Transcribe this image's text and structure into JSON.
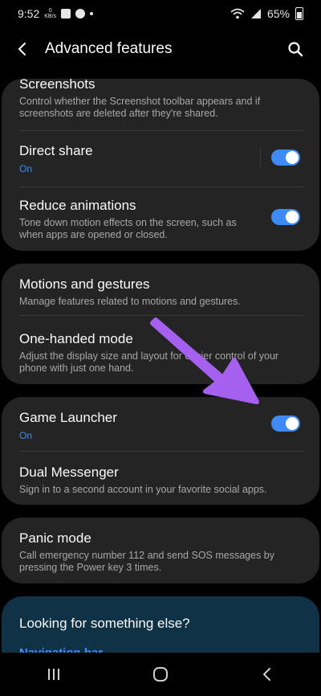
{
  "status": {
    "time": "9:52",
    "speed_value": "0",
    "speed_unit": "KB/s",
    "battery": "65%"
  },
  "header": {
    "title": "Advanced features",
    "back_icon": "back-arrow-icon",
    "search_icon": "search-icon"
  },
  "cards": [
    {
      "items": [
        {
          "title": "Screenshots",
          "desc": "Control whether the Screenshot toolbar appears and if screenshots are deleted after they're shared."
        },
        {
          "title": "Direct share",
          "state": "On",
          "toggle": true
        },
        {
          "title": "Reduce animations",
          "desc": "Tone down motion effects on the screen, such as when apps are opened or closed.",
          "toggle": true
        }
      ]
    },
    {
      "items": [
        {
          "title": "Motions and gestures",
          "desc": "Manage features related to motions and gestures."
        },
        {
          "title": "One-handed mode",
          "desc": "Adjust the display size and layout for easier control of your phone with just one hand."
        }
      ]
    },
    {
      "items": [
        {
          "title": "Game Launcher",
          "state": "On",
          "toggle": true
        },
        {
          "title": "Dual Messenger",
          "desc": "Sign in to a second account in your favorite social apps."
        }
      ]
    },
    {
      "items": [
        {
          "title": "Panic mode",
          "desc": "Call emergency number 112 and send SOS messages by pressing the Power key 3 times."
        }
      ]
    }
  ],
  "help": {
    "title": "Looking for something else?",
    "link": "Navigation bar"
  },
  "colors": {
    "accent": "#3e8af6",
    "card": "#242424",
    "help_card": "#103247",
    "annotation_arrow": "#a660f0"
  }
}
